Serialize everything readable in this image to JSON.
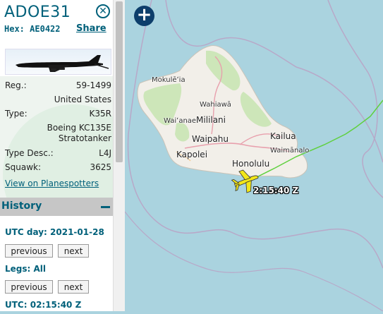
{
  "header": {
    "callsign": "ADOE31",
    "hex_label": "Hex:",
    "hex_value": "AE0422",
    "share_label": "Share",
    "close_glyph": "✕"
  },
  "details": {
    "reg_label": "Reg.:",
    "reg_value": "59-1499",
    "country_value": "United States",
    "type_label": "Type:",
    "type_value": "K35R",
    "model_line1": "Boeing KC135E",
    "model_line2": "Stratotanker",
    "type_desc_label": "Type Desc.:",
    "type_desc_value": "L4J",
    "squawk_label": "Squawk:",
    "squawk_value": "3625",
    "planespotters_link": "View on Planespotters"
  },
  "history": {
    "title": "History",
    "utc_day": "UTC day: 2021-01-28",
    "legs": "Legs: All",
    "utc_time": "UTC: 02:15:40 Z",
    "previous_label": "previous",
    "next_label": "next"
  },
  "map": {
    "zoom_in": "+",
    "labels": {
      "mokuleia": "Mokulēʻia",
      "wahiawa": "Wahiawā",
      "waianae": "Waiʻanae",
      "mililani": "Mililani",
      "waipahu": "Waipahu",
      "kapolei": "Kapolei",
      "kailua": "Kailua",
      "waimanalo": "Waimānalo",
      "honolulu": "Honolulu"
    },
    "aircraft_time": "2:15:40 Z",
    "colors": {
      "water": "#aad3df",
      "land": "#f2efe9",
      "vegetation": "#cde6b9",
      "track": "#5fd03e",
      "aircraft": "#f2e619"
    }
  }
}
